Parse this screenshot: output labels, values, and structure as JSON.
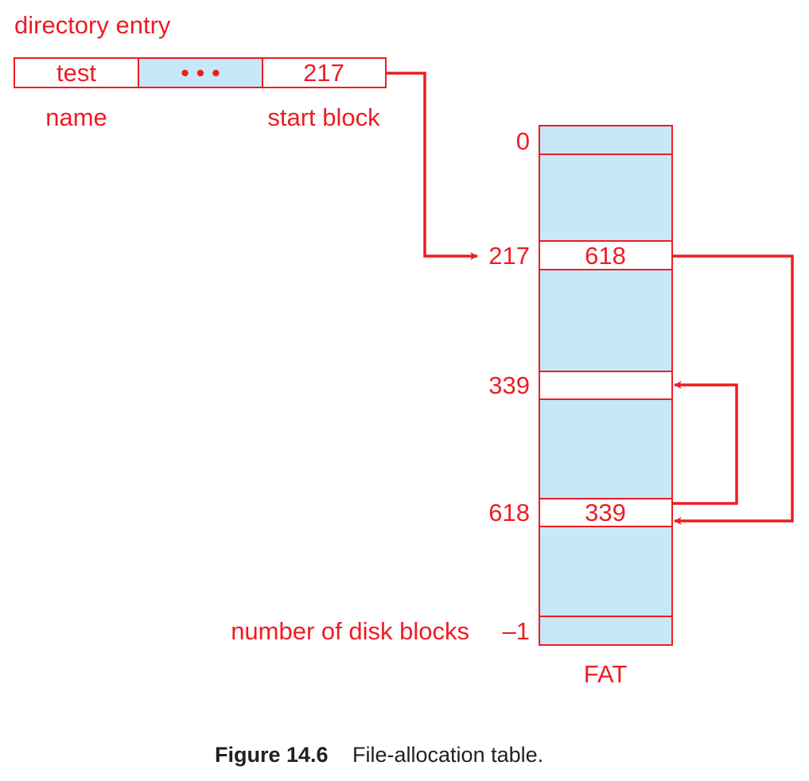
{
  "colors": {
    "stroke": "#ee1c24",
    "text": "#ee1c24",
    "fill_shaded": "#c6e8f9",
    "fill_plain": "#ffffff",
    "caption": "#231f20"
  },
  "directory_entry": {
    "title": "directory entry",
    "cells": [
      {
        "label": "test",
        "shaded": false
      },
      {
        "label": "• • •",
        "shaded": true
      },
      {
        "label": "217",
        "shaded": false
      }
    ],
    "name_label": "name",
    "start_block_label": "start block"
  },
  "fat": {
    "title": "FAT",
    "rows": [
      {
        "index_label": "0",
        "value": "",
        "shaded": true
      },
      {
        "index_label": "",
        "value": "",
        "shaded": true
      },
      {
        "index_label": "217",
        "value": "618",
        "shaded": false
      },
      {
        "index_label": "",
        "value": "",
        "shaded": true
      },
      {
        "index_label": "339",
        "value": "",
        "shaded": false
      },
      {
        "index_label": "",
        "value": "",
        "shaded": true
      },
      {
        "index_label": "618",
        "value": "339",
        "shaded": false
      },
      {
        "index_label": "",
        "value": "",
        "shaded": true
      },
      {
        "index_label": "–1",
        "value": "",
        "shaded": true
      }
    ],
    "end_row_label": "number of disk blocks"
  },
  "links": [
    {
      "from": "directory-entry-start-block",
      "to": "fat-row-217"
    },
    {
      "from": "fat-row-217",
      "to": "fat-row-618"
    },
    {
      "from": "fat-row-618",
      "to": "fat-row-339"
    }
  ],
  "caption": {
    "figure_number": "Figure 14.6",
    "text": "File-allocation table."
  }
}
